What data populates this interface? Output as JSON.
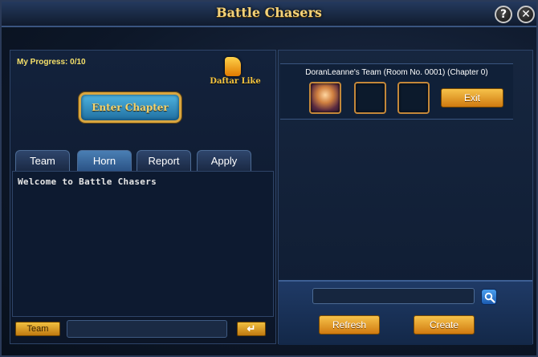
{
  "window": {
    "title": "Battle Chasers",
    "help_label": "?",
    "close_label": "✕"
  },
  "left": {
    "progress_label": "My Progress:",
    "progress_value": "0/10",
    "daftar_like_label": "Daftar Like",
    "enter_chapter_label": "Enter Chapter",
    "tabs": [
      {
        "label": "Team"
      },
      {
        "label": "Horn"
      },
      {
        "label": "Report"
      },
      {
        "label": "Apply"
      }
    ],
    "active_tab": "Horn",
    "chat_messages": [
      "Welcome to Battle Chasers"
    ],
    "team_button_label": "Team",
    "send_button_label": "↵",
    "chat_input_value": ""
  },
  "right": {
    "team_title": "DoranLeanne's Team (Room No. 0001) (Chapter 0)",
    "exit_label": "Exit",
    "search_value": "",
    "refresh_label": "Refresh",
    "create_label": "Create"
  },
  "colors": {
    "accent_gold": "#f3d27a",
    "button_orange": "#d07a10",
    "panel_blue": "#13223c"
  }
}
